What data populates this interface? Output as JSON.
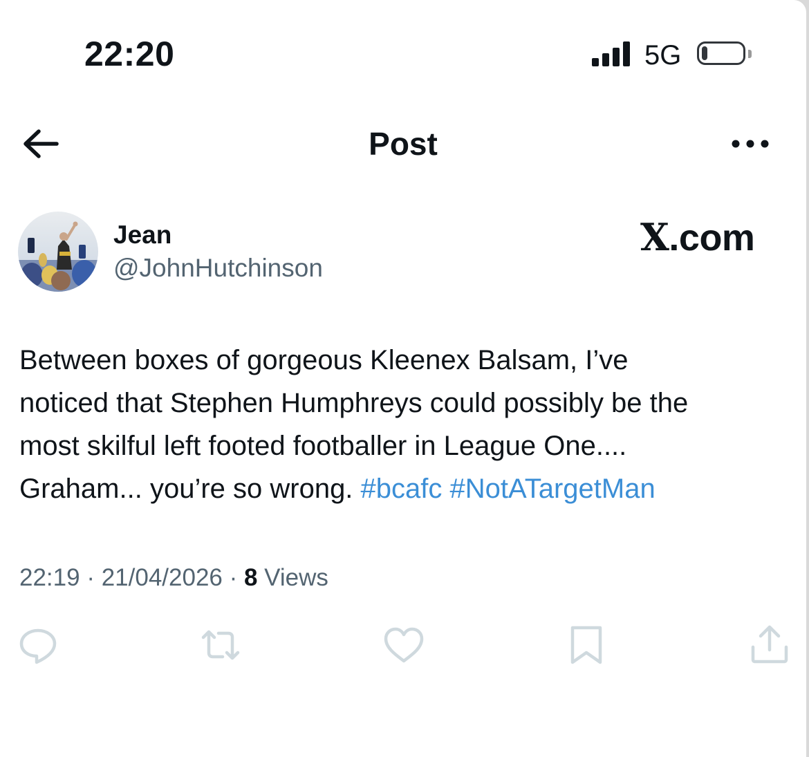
{
  "status_bar": {
    "time": "22:20",
    "network": "5G",
    "signal_bars": 4,
    "battery_level": 0.15
  },
  "header": {
    "title": "Post",
    "back_icon": "arrow-left-icon",
    "more_icon": "more-horizontal-icon"
  },
  "post": {
    "author_name": "Jean",
    "author_handle": "@JohnHutchinson",
    "watermark": {
      "x": "X",
      "domain": ".com"
    },
    "text_lines": [
      "Between boxes of gorgeous Kleenex Balsam, I’ve",
      "noticed that Stephen Humphreys could possibly be the",
      "most skilful left footed footballer in League One....",
      "Graham... you’re so wrong. "
    ],
    "hashtags": [
      "#bcafc",
      "#NotATargetMan"
    ],
    "time": "22:19",
    "separator": " · ",
    "date": "21/04/2026",
    "views_count": "8",
    "views_label": " Views"
  },
  "actions": [
    {
      "icon": "reply-icon"
    },
    {
      "icon": "repost-icon"
    },
    {
      "icon": "like-icon"
    },
    {
      "icon": "bookmark-icon"
    },
    {
      "icon": "share-icon"
    }
  ],
  "colors": {
    "text": "#0f1419",
    "secondary": "#536471",
    "hashtag": "#3b8ed6",
    "action_icon": "#cfd9de"
  }
}
